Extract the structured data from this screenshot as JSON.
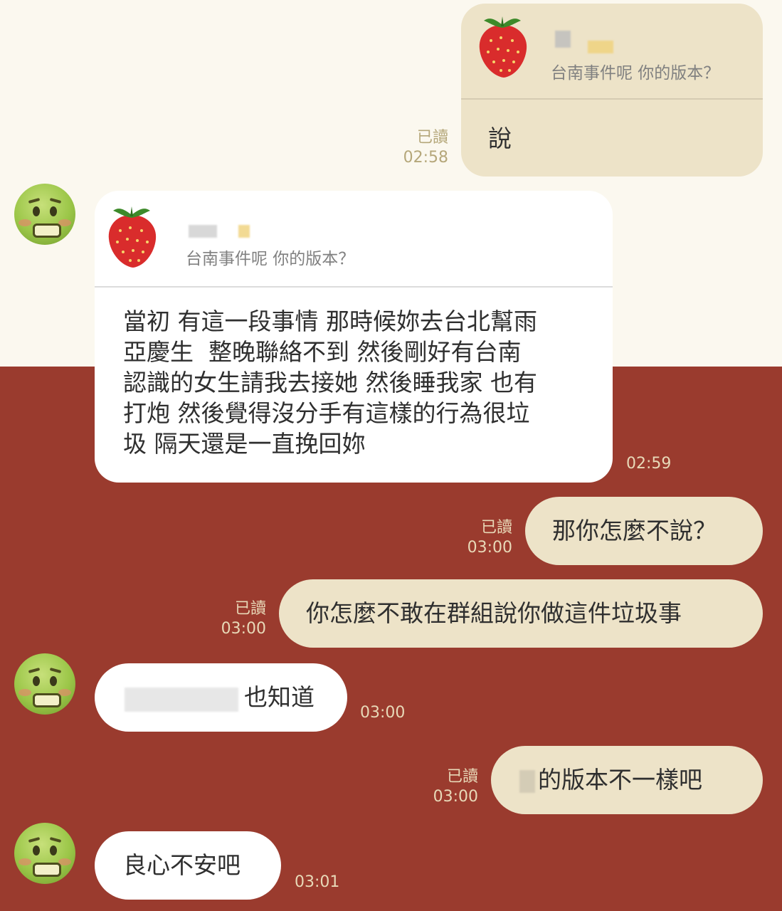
{
  "colors": {
    "top_background": "#fbf8ef",
    "bottom_background": "#9a3b2e",
    "outgoing_bubble": "#ede3c8",
    "incoming_bubble": "#ffffff"
  },
  "messages": [
    {
      "direction": "outgoing",
      "reply_quote": "台南事件呢 你的版本？",
      "text": "說",
      "read": "已讀",
      "time": "02:58"
    },
    {
      "direction": "incoming",
      "avatar": "nauseated-face-emoji",
      "reply_quote": "台南事件呢 你的版本？",
      "text": "當初 有這一段事情 那時候妳去台北幫雨\n亞慶生  整晚聯絡不到 然後剛好有台南\n認識的女生請我去接她 然後睡我家 也有\n打炮 然後覺得沒分手有這樣的行為很垃\n圾 隔天還是一直挽回妳",
      "time": "02:59"
    },
    {
      "direction": "outgoing",
      "text": "那你怎麼不說？",
      "read": "已讀",
      "time": "03:00"
    },
    {
      "direction": "outgoing",
      "text": "你怎麼不敢在群組說你做這件垃圾事",
      "read": "已讀",
      "time": "03:00"
    },
    {
      "direction": "incoming",
      "avatar": "nauseated-face-emoji",
      "text": "也知道",
      "time": "03:00"
    },
    {
      "direction": "outgoing",
      "text": "的版本不一樣吧",
      "read": "已讀",
      "time": "03:00"
    },
    {
      "direction": "incoming",
      "avatar": "nauseated-face-emoji",
      "text": "良心不安吧",
      "time": "03:01"
    }
  ]
}
